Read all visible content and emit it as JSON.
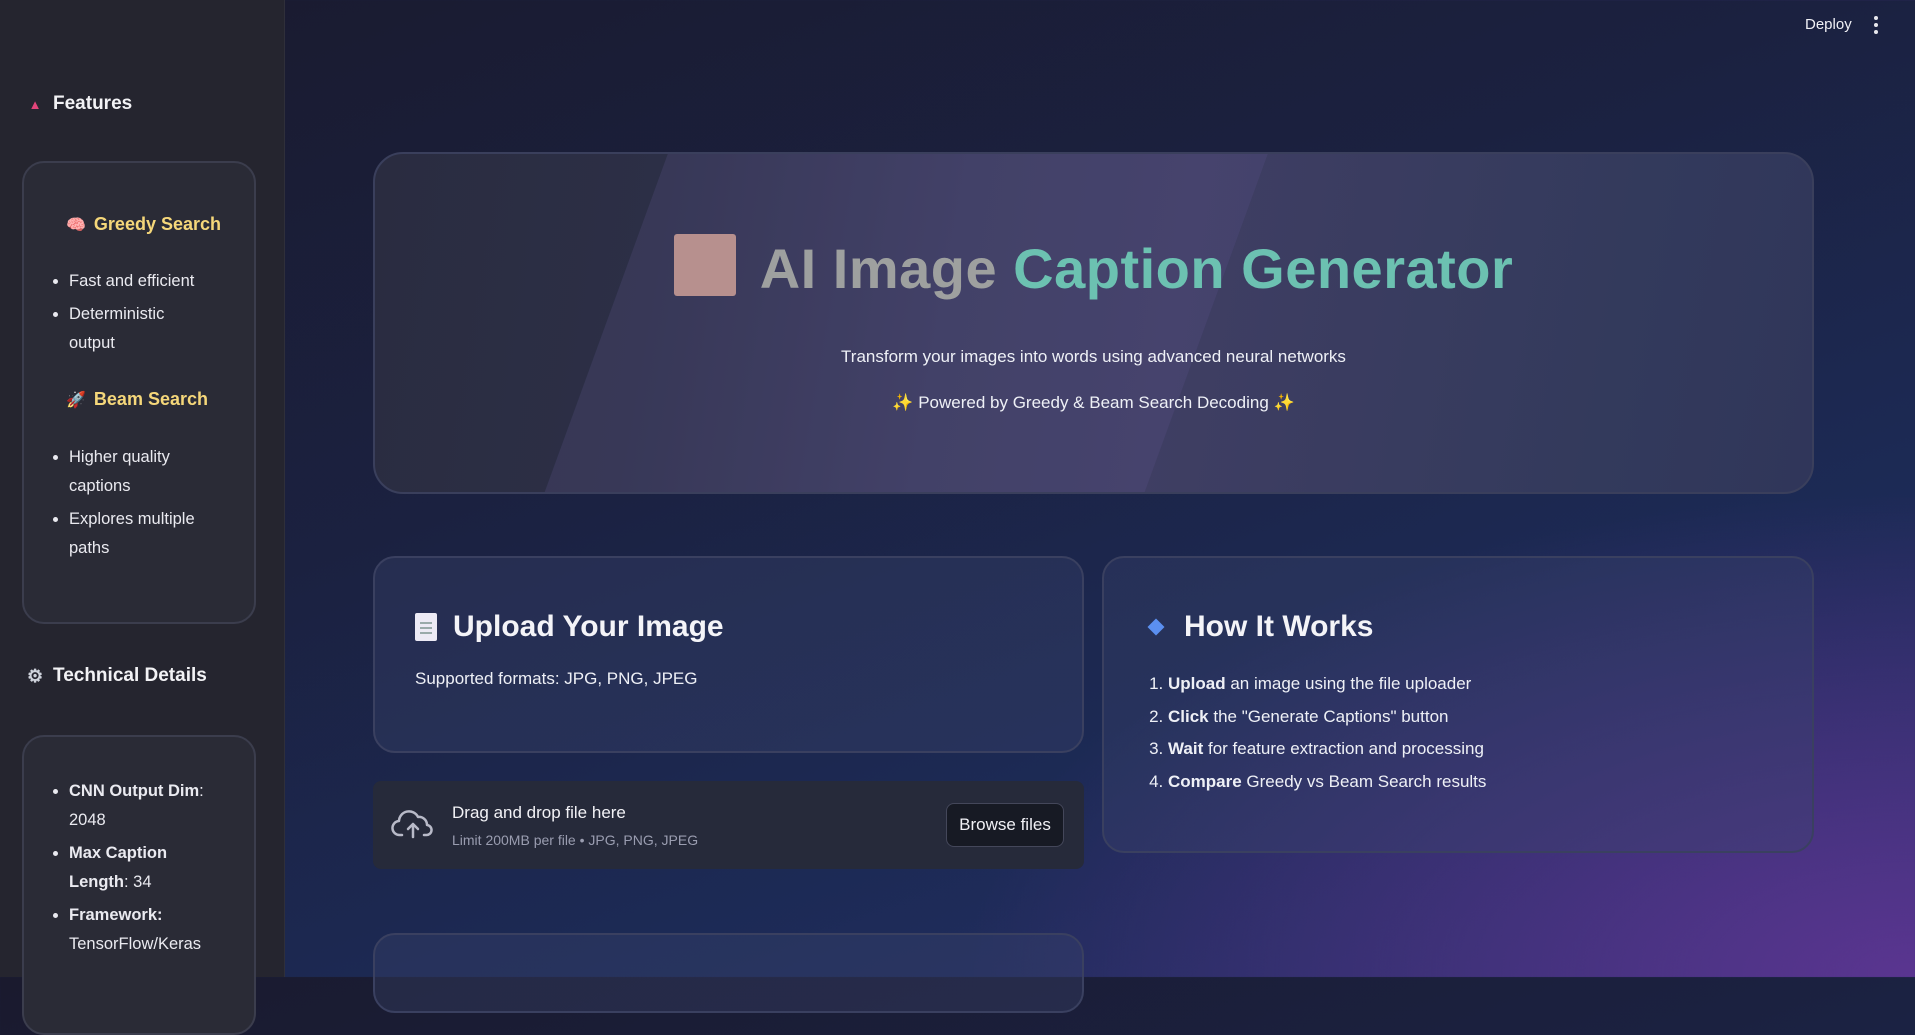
{
  "header": {
    "deploy_label": "Deploy"
  },
  "sidebar": {
    "features_heading": "Features",
    "greedy": {
      "title": "Greedy Search",
      "emoji": "🧠",
      "items": [
        "Fast and efficient",
        "Deterministic output"
      ]
    },
    "beam": {
      "title": "Beam Search",
      "emoji": "🚀",
      "items": [
        "Higher quality captions",
        "Explores multiple paths"
      ]
    },
    "tech_heading": "Technical Details",
    "tech_items": [
      {
        "label": "CNN Output Dim",
        "value": ": 2048"
      },
      {
        "label": "Max Caption Length",
        "value": ": 34"
      },
      {
        "label": "Framework:",
        "value": "TensorFlow/Keras"
      }
    ]
  },
  "hero": {
    "title_part1": "AI Image ",
    "title_part2": "Caption Generator",
    "subtitle": "Transform your images into words using advanced neural networks",
    "powered": "Powered by Greedy & Beam Search Decoding",
    "spark": "✨"
  },
  "upload": {
    "title": "Upload Your Image",
    "formats": "Supported formats: JPG, PNG, JPEG",
    "drag_text": "Drag and drop file here",
    "limit_text": "Limit 200MB per file • JPG, PNG, JPEG",
    "browse_label": "Browse files"
  },
  "how": {
    "title": "How It Works",
    "steps": [
      {
        "bold": "Upload",
        "rest": " an image using the file uploader"
      },
      {
        "bold": "Click",
        "rest": " the \"Generate Captions\" button"
      },
      {
        "bold": "Wait",
        "rest": " for feature extraction and processing"
      },
      {
        "bold": "Compare",
        "rest": " Greedy vs Beam Search results"
      }
    ]
  },
  "colors": {
    "accent_teal": "#6cc1b1",
    "feature_title": "#f5d77a",
    "sidebar_bg": "#25252f"
  },
  "icons": [
    "triangle-icon",
    "brain-icon",
    "rocket-icon",
    "gear-icon",
    "document-icon",
    "diamond-icon",
    "cloud-upload-icon",
    "kebab-menu-icon",
    "sparkle-icon"
  ]
}
